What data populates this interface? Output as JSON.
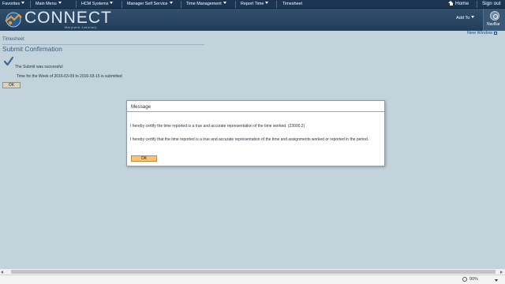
{
  "topnav": {
    "items": [
      {
        "label": "Favorites"
      },
      {
        "label": "Main Menu"
      },
      {
        "label": "HCM Systems"
      },
      {
        "label": "Manager Self Service"
      },
      {
        "label": "Time Management"
      },
      {
        "label": "Report Time"
      },
      {
        "label": "Timesheet"
      }
    ],
    "home": "Home",
    "signout": "Sign out"
  },
  "banner": {
    "logo_text": "CONNECT",
    "logo_sub": "Maryland Judiciary",
    "add_to": "Add To",
    "navbar": "NavBar"
  },
  "page": {
    "new_window": "New Window",
    "breadcrumb": "Timesheet",
    "title": "Submit Confirmation",
    "success_message": "The Submit was successful",
    "submitted_message": "Time for the Week of 2016-03-09 to  2016-03-15 is submitted",
    "ok_label": "OK"
  },
  "modal": {
    "title": "Message",
    "message1": "I hereby certify the time reported is a true and accurate representation of the time worked. (23000,2)",
    "message2": "I hereby certify that the time reported is a true and accurate representation of the time and assignments worked or reported in the period.",
    "ok_label": "OK"
  },
  "statusbar": {
    "zoom": "90%"
  },
  "colors": {
    "nav_bg": "#1b3553",
    "page_bg": "#c3d3dc",
    "title_color": "#3c5e80",
    "ok_button": "#f7c27c"
  }
}
